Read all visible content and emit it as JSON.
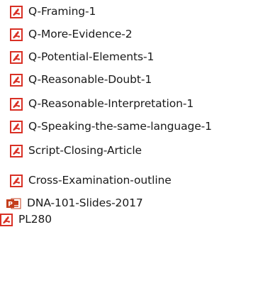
{
  "file_list": {
    "items": [
      {
        "name": "Q-Framing-1",
        "icon": "pdf-icon"
      },
      {
        "name": "Q-More-Evidence-2",
        "icon": "pdf-icon"
      },
      {
        "name": "Q-Potential-Elements-1",
        "icon": "pdf-icon"
      },
      {
        "name": "Q-Reasonable-Doubt-1",
        "icon": "pdf-icon"
      },
      {
        "name": "Q-Reasonable-Interpretation-1",
        "icon": "pdf-icon"
      },
      {
        "name": "Q-Speaking-the-same-language-1",
        "icon": "pdf-icon"
      },
      {
        "name": "Script-Closing-Article",
        "icon": "pdf-icon"
      },
      {
        "name": "Cross-Examination-outline",
        "icon": "pdf-icon"
      },
      {
        "name": "DNA-101-Slides-2017",
        "icon": "powerpoint-icon"
      },
      {
        "name": "PL280",
        "icon": "pdf-icon"
      }
    ]
  },
  "colors": {
    "pdf_red": "#d93025",
    "powerpoint_red": "#c43e1c"
  }
}
